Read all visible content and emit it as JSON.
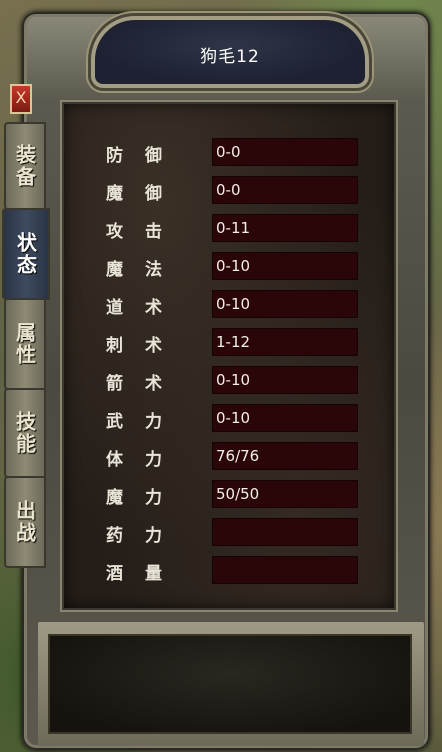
{
  "window": {
    "title": "狗毛12",
    "close_label": "X"
  },
  "tabs": [
    {
      "label": "装备",
      "active": false
    },
    {
      "label": "状态",
      "active": true
    },
    {
      "label": "属性",
      "active": false
    },
    {
      "label": "技能",
      "active": false
    },
    {
      "label": "出战",
      "active": false
    }
  ],
  "stats": [
    {
      "label": "防御",
      "value": "0-0"
    },
    {
      "label": "魔御",
      "value": "0-0"
    },
    {
      "label": "攻击",
      "value": "0-11"
    },
    {
      "label": "魔法",
      "value": "0-10"
    },
    {
      "label": "道术",
      "value": "0-10"
    },
    {
      "label": "刺术",
      "value": "1-12"
    },
    {
      "label": "箭术",
      "value": "0-10"
    },
    {
      "label": "武力",
      "value": "0-10"
    },
    {
      "label": "体力",
      "value": "76/76"
    },
    {
      "label": "魔力",
      "value": "50/50"
    },
    {
      "label": "药力",
      "value": ""
    },
    {
      "label": "酒量",
      "value": ""
    }
  ],
  "colors": {
    "value_bg": "#2a0608",
    "active_tab": "#2a3446",
    "frame": "#5c5a4e"
  }
}
